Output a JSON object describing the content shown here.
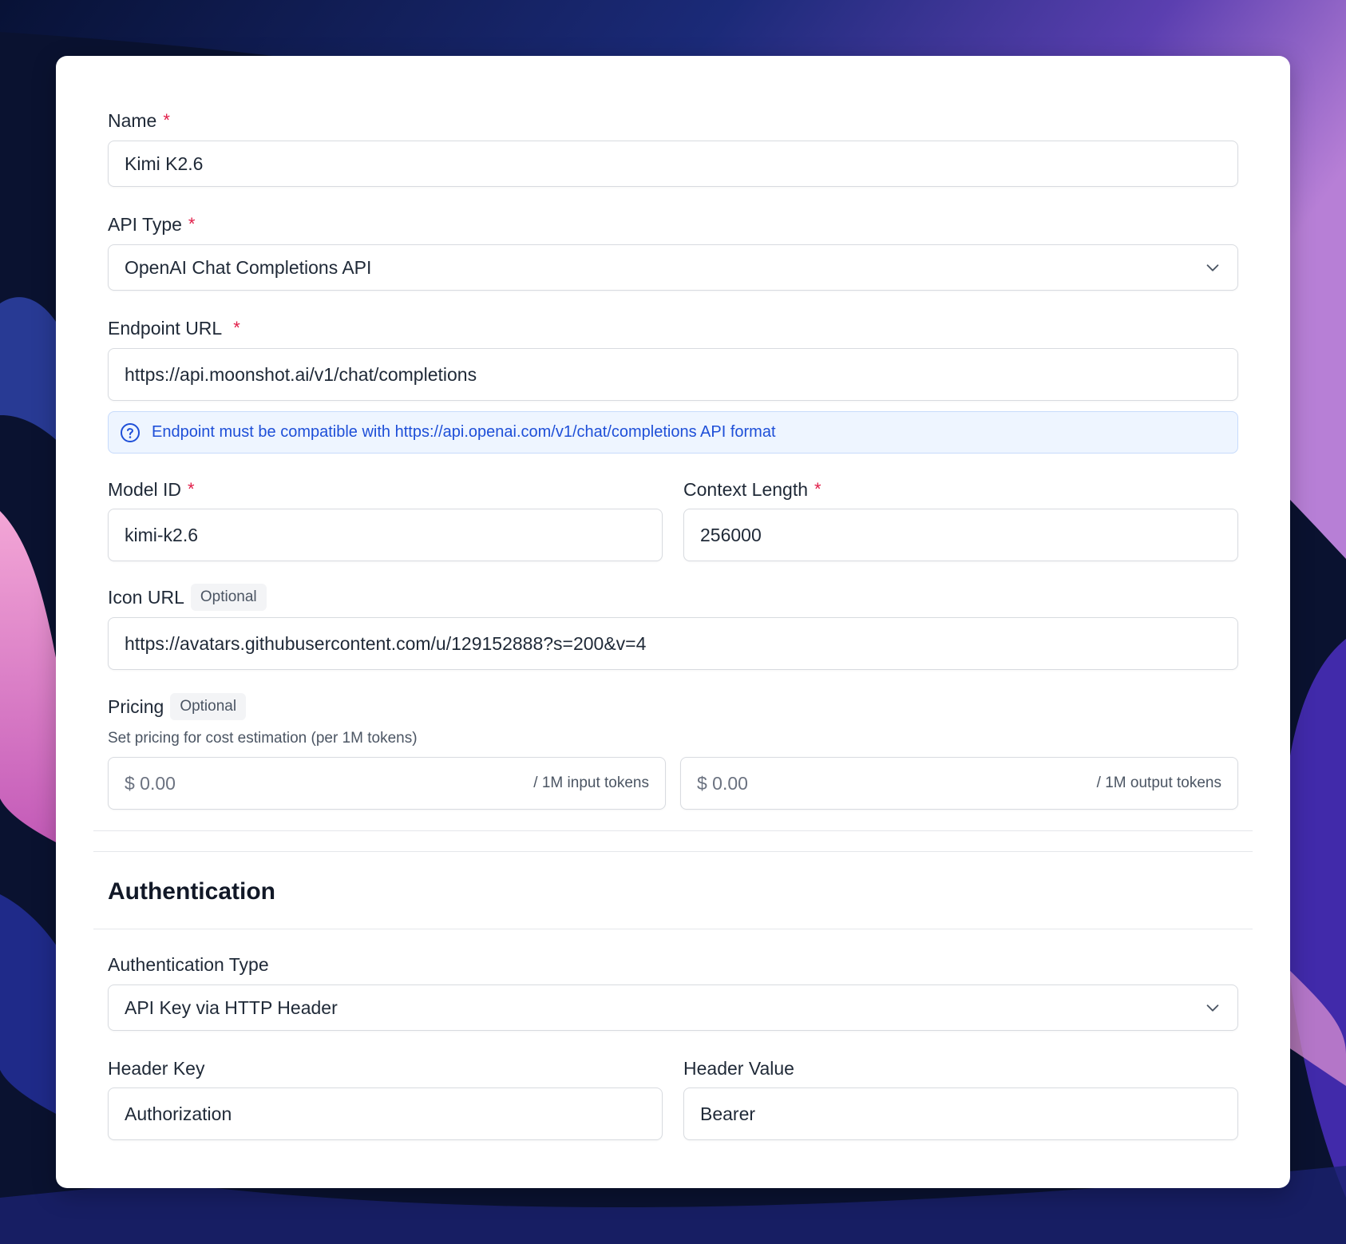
{
  "form": {
    "name": {
      "label": "Name",
      "required_mark": "*",
      "value": "Kimi K2.6"
    },
    "api_type": {
      "label": "API Type",
      "required_mark": "*",
      "value": "OpenAI Chat Completions API"
    },
    "endpoint": {
      "label": "Endpoint URL",
      "required_mark": "*",
      "value": "https://api.moonshot.ai/v1/chat/completions",
      "info": "Endpoint must be compatible with https://api.openai.com/v1/chat/completions API format"
    },
    "model_id": {
      "label": "Model ID",
      "required_mark": "*",
      "value": "kimi-k2.6"
    },
    "context_length": {
      "label": "Context Length",
      "required_mark": "*",
      "value": "256000"
    },
    "icon_url": {
      "label": "Icon URL",
      "badge": "Optional",
      "value": "https://avatars.githubusercontent.com/u/129152888?s=200&v=4"
    },
    "pricing": {
      "label": "Pricing",
      "badge": "Optional",
      "helper": "Set pricing for cost estimation (per 1M tokens)",
      "input_placeholder": "$ 0.00",
      "input_suffix": "/ 1M input tokens",
      "output_placeholder": "$ 0.00",
      "output_suffix": "/ 1M output tokens"
    }
  },
  "authentication": {
    "title": "Authentication",
    "type": {
      "label": "Authentication Type",
      "value": "API Key via HTTP Header"
    },
    "header_key": {
      "label": "Header Key",
      "value": "Authorization"
    },
    "header_value": {
      "label": "Header Value",
      "value": "Bearer"
    }
  },
  "colors": {
    "required": "#e11d48",
    "info_text": "#1e4fd8",
    "info_bg": "#eef5ff"
  },
  "icons": {
    "dropdown": "chevron-down-icon",
    "info": "question-circle-icon"
  }
}
